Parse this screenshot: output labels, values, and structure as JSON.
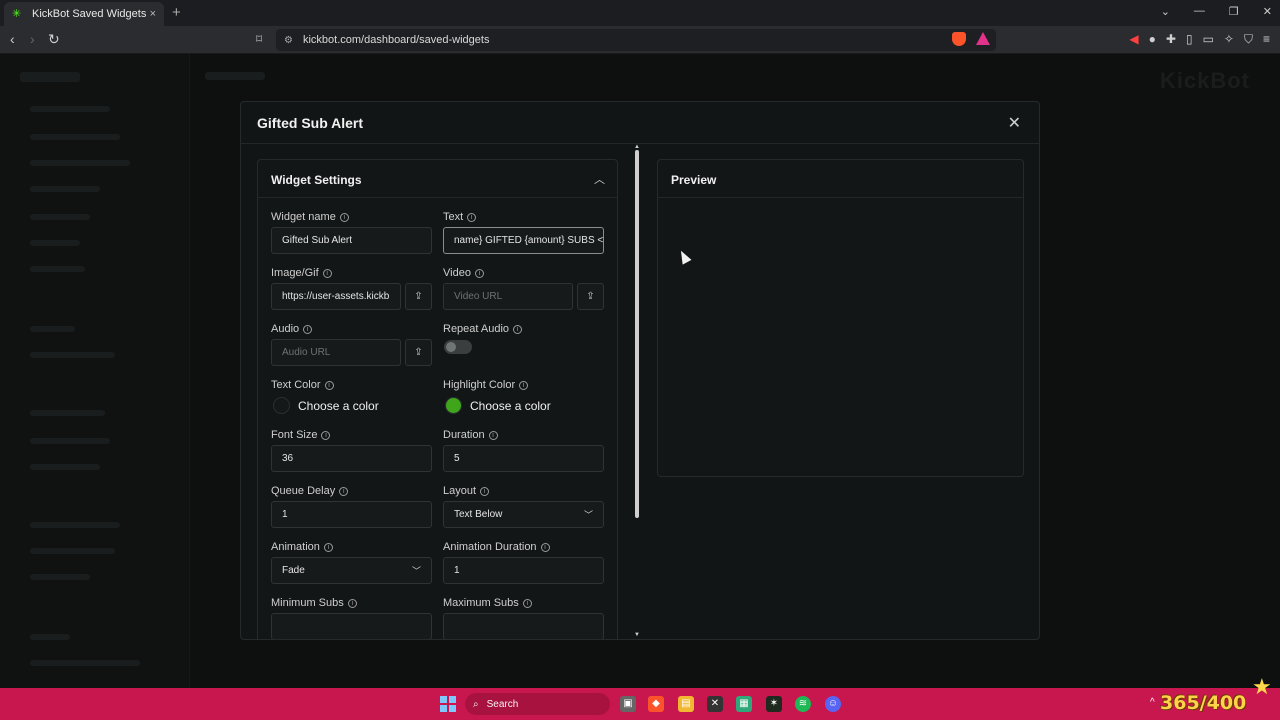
{
  "browser": {
    "tab_title": "KickBot Saved Widgets",
    "tab_close": "×",
    "new_tab": "+",
    "url": "kickbot.com/dashboard/saved-widgets"
  },
  "page": {
    "brand": "KickBot"
  },
  "modal": {
    "title": "Gifted Sub Alert",
    "close": "✕",
    "settings": {
      "title": "Widget Settings",
      "fields": {
        "widget_name": {
          "label": "Widget name",
          "value": "Gifted Sub Alert"
        },
        "text": {
          "label": "Text",
          "value": "name} GIFTED {amount} SUBS <"
        },
        "image": {
          "label": "Image/Gif",
          "value": "https://user-assets.kickb"
        },
        "video": {
          "label": "Video",
          "placeholder": "Video URL"
        },
        "audio": {
          "label": "Audio",
          "placeholder": "Audio URL"
        },
        "repeat_audio": {
          "label": "Repeat Audio",
          "enabled": false
        },
        "text_color": {
          "label": "Text Color",
          "value": "Choose a color",
          "color": "#151818"
        },
        "highlight_color": {
          "label": "Highlight Color",
          "value": "Choose a color",
          "color": "#3fa61c"
        },
        "font_size": {
          "label": "Font Size",
          "value": "36"
        },
        "duration": {
          "label": "Duration",
          "value": "5"
        },
        "queue_delay": {
          "label": "Queue Delay",
          "value": "1"
        },
        "layout": {
          "label": "Layout",
          "value": "Text Below"
        },
        "animation": {
          "label": "Animation",
          "value": "Fade"
        },
        "animation_duration": {
          "label": "Animation Duration",
          "value": "1"
        },
        "min_subs": {
          "label": "Minimum Subs",
          "value": ""
        },
        "max_subs": {
          "label": "Maximum Subs",
          "value": ""
        }
      }
    },
    "preview": {
      "title": "Preview"
    }
  },
  "taskbar": {
    "search": "Search",
    "counter": "365/400",
    "accent": "#c8174f"
  }
}
